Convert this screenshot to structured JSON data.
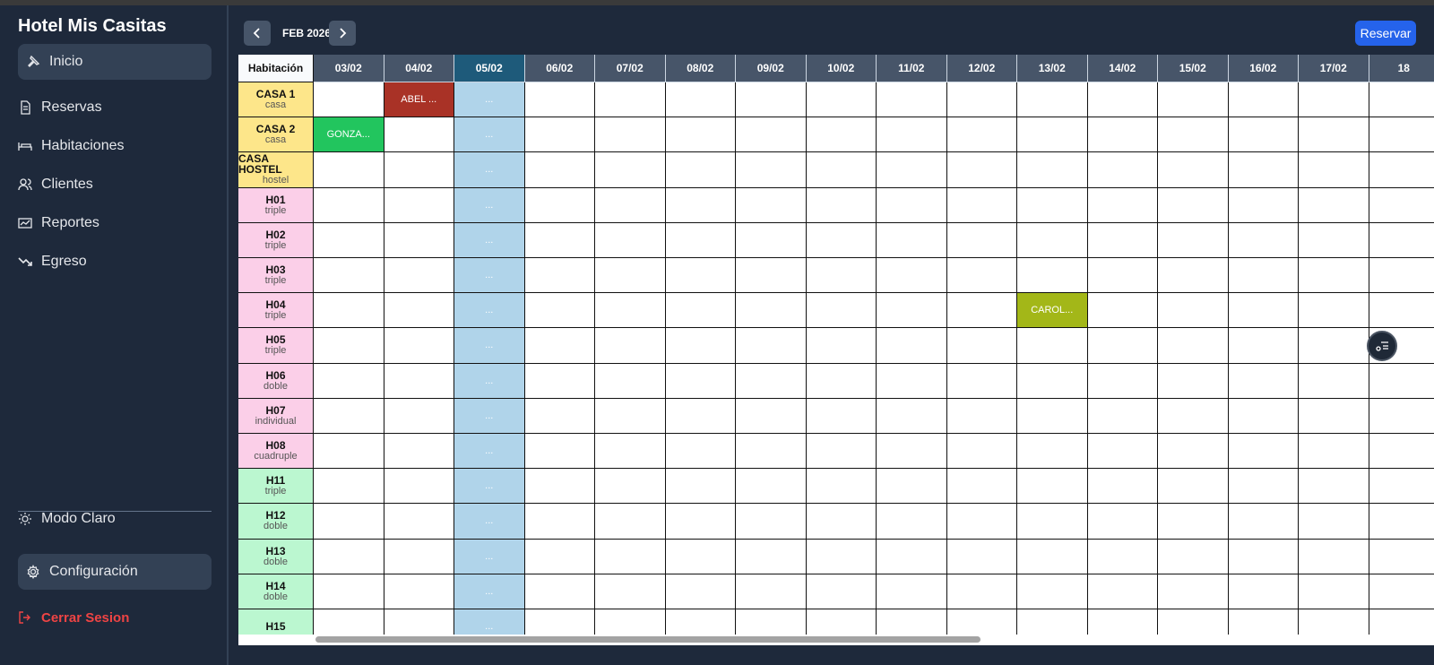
{
  "app": {
    "title": "Hotel Mis Casitas"
  },
  "sidebar": {
    "items": [
      {
        "label": "Inicio",
        "icon": "pin-icon"
      },
      {
        "label": "Reservas",
        "icon": "document-icon"
      },
      {
        "label": "Habitaciones",
        "icon": "bed-icon"
      },
      {
        "label": "Clientes",
        "icon": "users-icon"
      },
      {
        "label": "Reportes",
        "icon": "chart-icon"
      },
      {
        "label": "Egreso",
        "icon": "trend-down-icon"
      }
    ],
    "theme_toggle": "Modo Claro",
    "settings": "Configuración",
    "logout": "Cerrar Sesion"
  },
  "calendar": {
    "month": "FEB 2026",
    "reserve_label": "Reservar",
    "header_first": "Habitación",
    "today_marker": "...",
    "dates": [
      "03/02",
      "04/02",
      "05/02",
      "06/02",
      "07/02",
      "08/02",
      "09/02",
      "10/02",
      "11/02",
      "12/02",
      "13/02",
      "14/02",
      "15/02",
      "16/02",
      "17/02",
      "18"
    ],
    "today_index": 2,
    "rooms": [
      {
        "name": "CASA 1",
        "type": "casa",
        "color": "#fde68a"
      },
      {
        "name": "CASA 2",
        "type": "casa",
        "color": "#fde68a"
      },
      {
        "name": "CASA HOSTEL",
        "type": "hostel",
        "color": "#fde68a"
      },
      {
        "name": "H01",
        "type": "triple",
        "color": "#fbcfe8"
      },
      {
        "name": "H02",
        "type": "triple",
        "color": "#fbcfe8"
      },
      {
        "name": "H03",
        "type": "triple",
        "color": "#fbcfe8"
      },
      {
        "name": "H04",
        "type": "triple",
        "color": "#fbcfe8"
      },
      {
        "name": "H05",
        "type": "triple",
        "color": "#fbcfe8"
      },
      {
        "name": "H06",
        "type": "doble",
        "color": "#fbcfe8"
      },
      {
        "name": "H07",
        "type": "individual",
        "color": "#fbcfe8"
      },
      {
        "name": "H08",
        "type": "cuadruple",
        "color": "#fbcfe8"
      },
      {
        "name": "H11",
        "type": "triple",
        "color": "#bbf7d0"
      },
      {
        "name": "H12",
        "type": "doble",
        "color": "#bbf7d0"
      },
      {
        "name": "H13",
        "type": "doble",
        "color": "#bbf7d0"
      },
      {
        "name": "H14",
        "type": "doble",
        "color": "#bbf7d0"
      },
      {
        "name": "H15",
        "type": "",
        "color": "#bbf7d0"
      }
    ],
    "bookings": [
      {
        "room": 0,
        "col": 1,
        "label": "ABEL ...",
        "color": "#a93226"
      },
      {
        "room": 1,
        "col": 0,
        "label": "GONZA...",
        "color": "#22c55e"
      },
      {
        "room": 6,
        "col": 10,
        "label": "CAROL...",
        "color": "#a3b718"
      }
    ]
  }
}
